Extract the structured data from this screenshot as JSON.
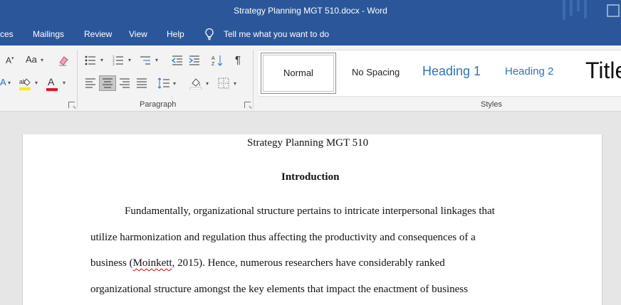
{
  "titlebar": {
    "title": "Strategy Planning MGT 510.docx  -  Word"
  },
  "tabs": {
    "items": [
      "ces",
      "Mailings",
      "Review",
      "View",
      "Help"
    ],
    "tell_me": "Tell me what you want to do"
  },
  "ribbon": {
    "font_group": {
      "font_size_label": "A",
      "change_case_label": "Aa",
      "font_color_label": "A"
    },
    "paragraph_group": {
      "label": "Paragraph",
      "sort_label": "A↓Z",
      "pilcrow": "¶"
    },
    "styles_group": {
      "label": "Styles",
      "items": [
        "Normal",
        "No Spacing",
        "Heading 1",
        "Heading 2",
        "Title"
      ]
    },
    "colors": {
      "highlight": "#ffeb00",
      "font_color": "#e81123"
    }
  },
  "document": {
    "title_line": "Strategy Planning MGT 510",
    "heading": "Introduction",
    "lines": [
      "Fundamentally, organizational structure pertains to intricate interpersonal linkages that",
      "utilize harmonization and regulation thus affecting the productivity and consequences of a"
    ],
    "line3_prefix": "business (",
    "line3_misspelled": "Moinkett",
    "line3_suffix": ", 2015). Hence, numerous researchers have considerably ranked",
    "line4": "organizational structure amongst the key elements that impact the enactment of business"
  },
  "colors": {
    "accent": "#2b579a"
  }
}
